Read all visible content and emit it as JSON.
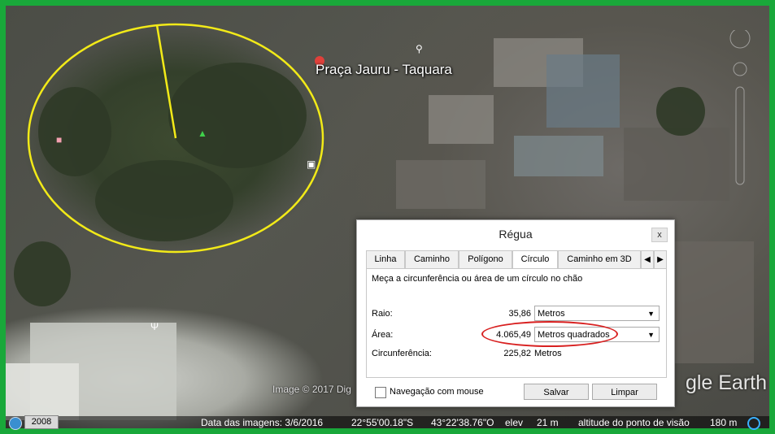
{
  "map": {
    "place_label": "Praça Jauru - Taquara",
    "watermark": "gle Earth",
    "copyright": "Image © 2017 Dig"
  },
  "status": {
    "history_year": "2008",
    "image_date": "Data das imagens: 3/6/2016",
    "lat": "22°55'00.18\"S",
    "lon": "43°22'38.76\"O",
    "elev_label": "elev",
    "elev_value": "21 m",
    "eye_label": "altitude do ponto de visão",
    "eye_value": "180 m"
  },
  "dialog": {
    "title": "Régua",
    "close": "x",
    "tabs": [
      "Linha",
      "Caminho",
      "Polígono",
      "Círculo",
      "Caminho em 3D"
    ],
    "active_tab": "Círculo",
    "description": "Meça a circunferência ou área de um círculo no chão",
    "radius_label": "Raio:",
    "radius_value": "35,86",
    "radius_unit": "Metros",
    "area_label": "Área:",
    "area_value": "4.065,49",
    "area_unit": "Metros quadrados",
    "circ_label": "Circunferência:",
    "circ_value": "225,82",
    "circ_unit": "Metros",
    "mouse_nav": "Navegação com mouse",
    "save": "Salvar",
    "clear": "Limpar"
  },
  "colors": {
    "frame": "#19a83a",
    "measure_circle": "#f2ea18",
    "highlight": "#d82020"
  },
  "icons": [
    "pin-icon",
    "search-icon",
    "lock-icon",
    "tree-icon",
    "bus-icon",
    "restaurant-icon",
    "pegman-icon",
    "zoom-slider-icon",
    "history-clock-icon",
    "globe-icon"
  ]
}
